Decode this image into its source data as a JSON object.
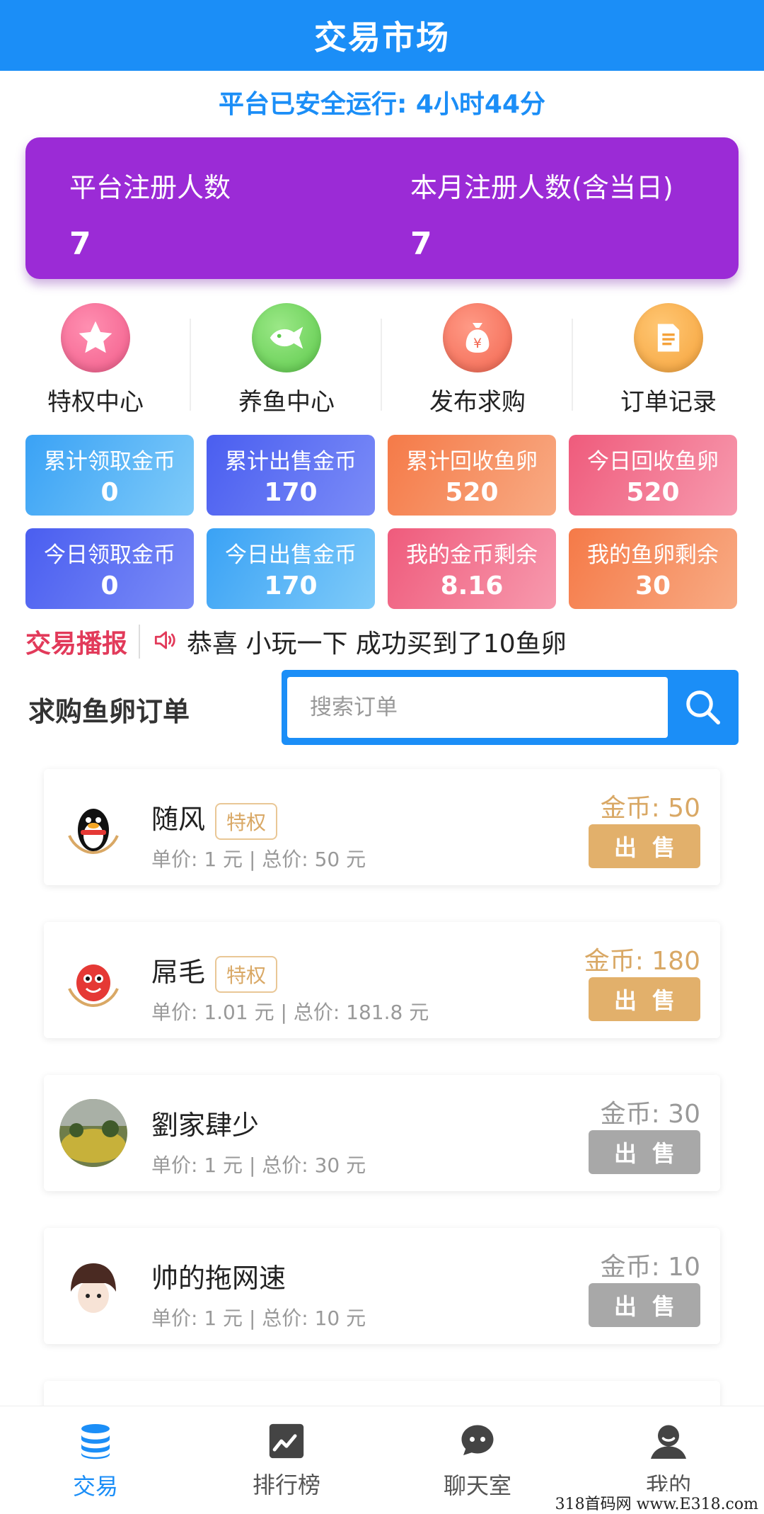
{
  "header": {
    "title": "交易市场"
  },
  "uptime": "平台已安全运行: 4小时44分",
  "stats": [
    {
      "label": "平台注册人数",
      "value": "7"
    },
    {
      "label": "本月注册人数(含当日)",
      "value": "7"
    }
  ],
  "menu": [
    {
      "label": "特权中心",
      "icon": "star-icon",
      "color": "#f25c8a"
    },
    {
      "label": "养鱼中心",
      "icon": "fish-icon",
      "color": "#5cc94a"
    },
    {
      "label": "发布求购",
      "icon": "money-bag-icon",
      "color": "#f2654f"
    },
    {
      "label": "订单记录",
      "icon": "document-icon",
      "color": "#f5a23a"
    }
  ],
  "tiles": [
    {
      "label": "累计领取金币",
      "value": "0",
      "color1": "#3aa2f5",
      "color2": "#7fcbf9"
    },
    {
      "label": "累计出售金币",
      "value": "170",
      "color1": "#4a5ef0",
      "color2": "#7b8cf7"
    },
    {
      "label": "累计回收鱼卵",
      "value": "520",
      "color1": "#f57a48",
      "color2": "#f8ab84"
    },
    {
      "label": "今日回收鱼卵",
      "value": "520",
      "color1": "#ef5b7c",
      "color2": "#f79aae"
    },
    {
      "label": "今日领取金币",
      "value": "0",
      "color1": "#4a5ef0",
      "color2": "#7b8cf7"
    },
    {
      "label": "今日出售金币",
      "value": "170",
      "color1": "#3aa2f5",
      "color2": "#7fcbf9"
    },
    {
      "label": "我的金币剩余",
      "value": "8.16",
      "color1": "#ef5b7c",
      "color2": "#f79aae"
    },
    {
      "label": "我的鱼卵剩余",
      "value": "30",
      "color1": "#f57a48",
      "color2": "#f8ab84"
    }
  ],
  "broadcast": {
    "title": "交易播报",
    "text": "恭喜 小玩一下 成功买到了10鱼卵"
  },
  "search": {
    "title": "求购鱼卵订单",
    "placeholder": "搜索订单"
  },
  "orders": [
    {
      "name": "随风",
      "badge": "特权",
      "price": "单价: 1 元 | 总价: 50 元",
      "coins": "金币: 50",
      "sell": "出售",
      "status": "active"
    },
    {
      "name": "屌毛",
      "badge": "特权",
      "price": "单价: 1.01 元 | 总价: 181.8 元",
      "coins": "金币: 180",
      "sell": "出售",
      "status": "active"
    },
    {
      "name": "劉家肆少",
      "badge": "",
      "price": "单价: 1 元 | 总价: 30 元",
      "coins": "金币: 30",
      "sell": "出售",
      "status": "disabled"
    },
    {
      "name": "帅的拖网速",
      "badge": "",
      "price": "单价: 1 元 | 总价: 10 元",
      "coins": "金币: 10",
      "sell": "出售",
      "status": "disabled"
    }
  ],
  "tabs": [
    {
      "label": "交易",
      "icon": "coin-stack-icon",
      "active": true
    },
    {
      "label": "排行榜",
      "icon": "trend-chart-icon",
      "active": false
    },
    {
      "label": "聊天室",
      "icon": "chat-bubble-icon",
      "active": false
    },
    {
      "label": "我的",
      "icon": "user-icon",
      "active": false
    }
  ],
  "watermark": "318首码网 www.E318.com"
}
